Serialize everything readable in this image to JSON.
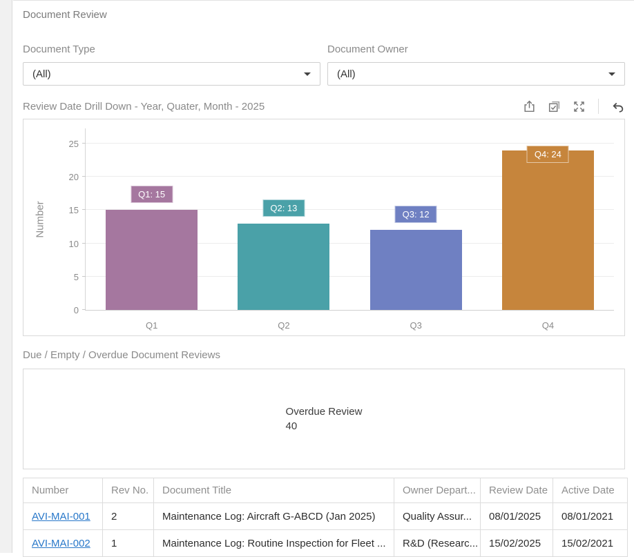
{
  "page": {
    "title": "Document Review"
  },
  "filters": [
    {
      "label": "Document Type",
      "value": "(All)"
    },
    {
      "label": "Document Owner",
      "value": "(All)"
    }
  ],
  "chart_section": {
    "title": "Review Date Drill Down - Year, Quater, Month - 2025",
    "toolbar_icons": [
      "export",
      "multi-select",
      "maximize",
      "undo"
    ]
  },
  "chart_data": {
    "type": "bar",
    "title": "Review Date Drill Down - Year, Quater, Month - 2025",
    "categories": [
      "Q1",
      "Q2",
      "Q3",
      "Q4"
    ],
    "values": [
      15,
      13,
      12,
      24
    ],
    "point_labels": [
      "Q1: 15",
      "Q2: 13",
      "Q3: 12",
      "Q4: 24"
    ],
    "bar_colors": [
      "#a5779f",
      "#4aa1a8",
      "#6f80c2",
      "#c6853c"
    ],
    "xlabel": "",
    "ylabel": "Number",
    "ylim": [
      0,
      25
    ],
    "yticks": [
      0,
      5,
      10,
      15,
      20,
      25
    ],
    "grid": true,
    "legend": false
  },
  "overdue_section": {
    "title": "Due / Empty / Overdue Document Reviews",
    "metric_label": "Overdue Review",
    "metric_value": "40"
  },
  "table": {
    "columns": [
      "Number",
      "Rev No.",
      "Document Title",
      "Owner Depart...",
      "Review Date",
      "Active Date"
    ],
    "rows": [
      [
        "AVI-MAI-001",
        "2",
        "Maintenance Log: Aircraft G-ABCD (Jan 2025)",
        "Quality Assur...",
        "08/01/2025",
        "08/01/2021"
      ],
      [
        "AVI-MAI-002",
        "1",
        "Maintenance Log: Routine Inspection for Fleet ...",
        "R&D (Researc...",
        "15/02/2025",
        "15/02/2021"
      ]
    ]
  }
}
